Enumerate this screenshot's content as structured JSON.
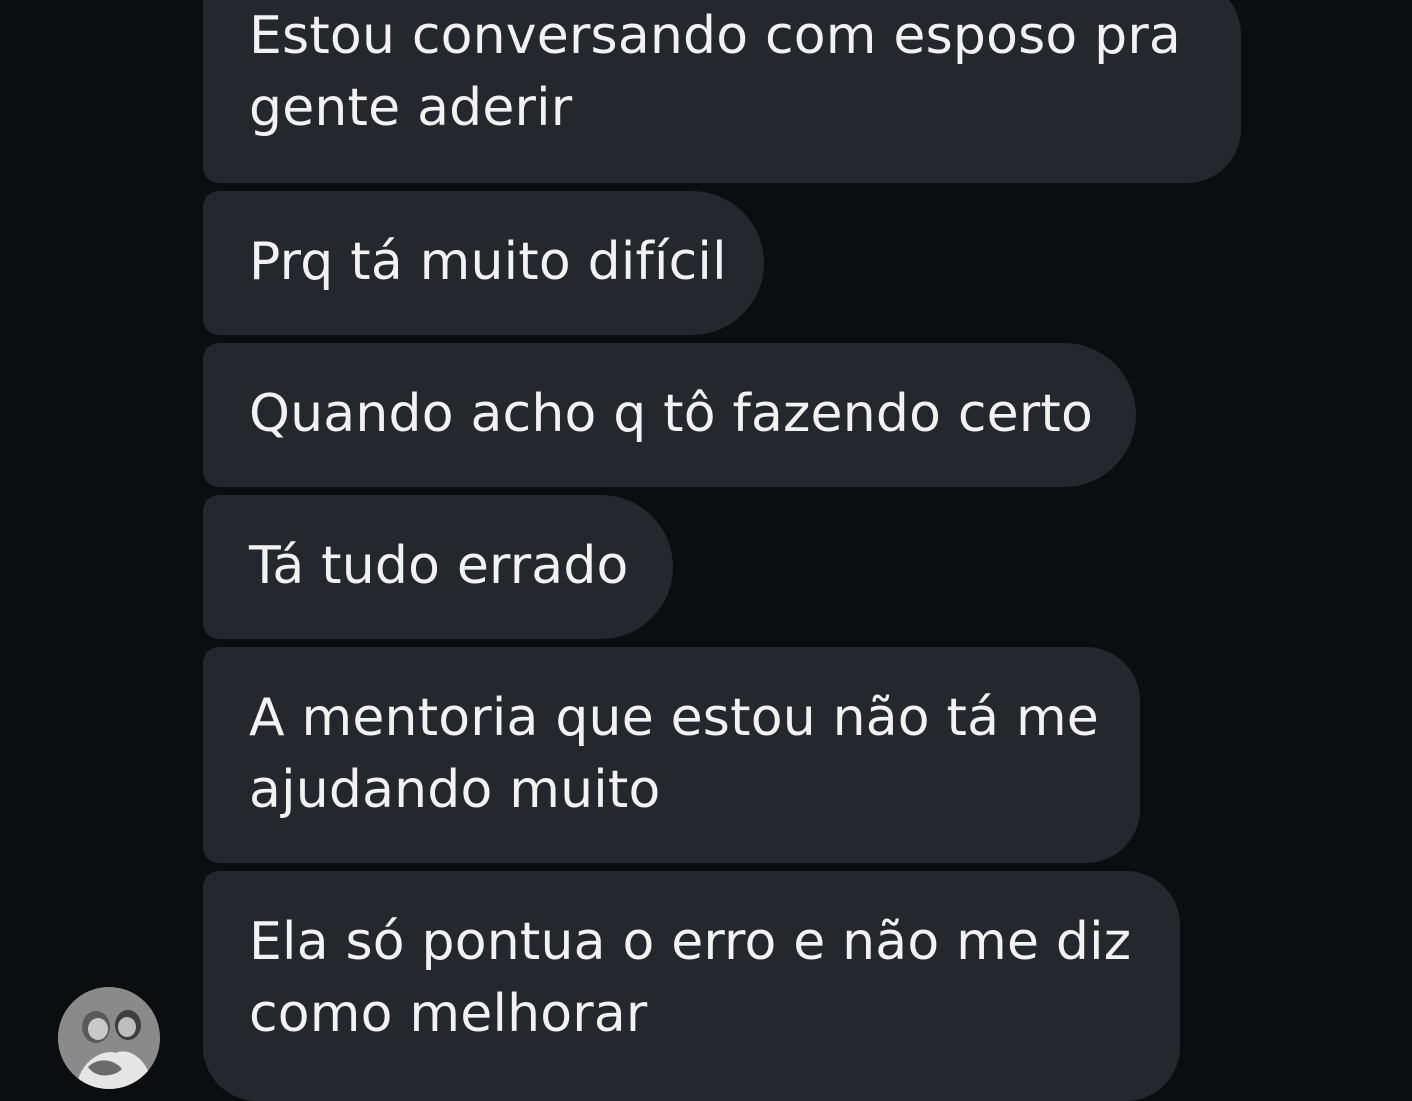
{
  "messages": [
    {
      "lines": [
        "Estou conversando com esposo pra",
        "gente aderir"
      ]
    },
    {
      "lines": [
        "Prq tá muito difícil"
      ]
    },
    {
      "lines": [
        "Quando acho q tô fazendo certo"
      ]
    },
    {
      "lines": [
        "Tá tudo errado"
      ]
    },
    {
      "lines": [
        "A mentoria que estou não tá me",
        "ajudando muito"
      ]
    },
    {
      "lines": [
        "Ela só pontua o erro e não me diz",
        "como melhorar"
      ]
    }
  ],
  "sender": {
    "avatar": "profile-photo"
  },
  "colors": {
    "background": "#0b0d10",
    "bubble": "#26272c",
    "text": "#f2f2f4"
  }
}
